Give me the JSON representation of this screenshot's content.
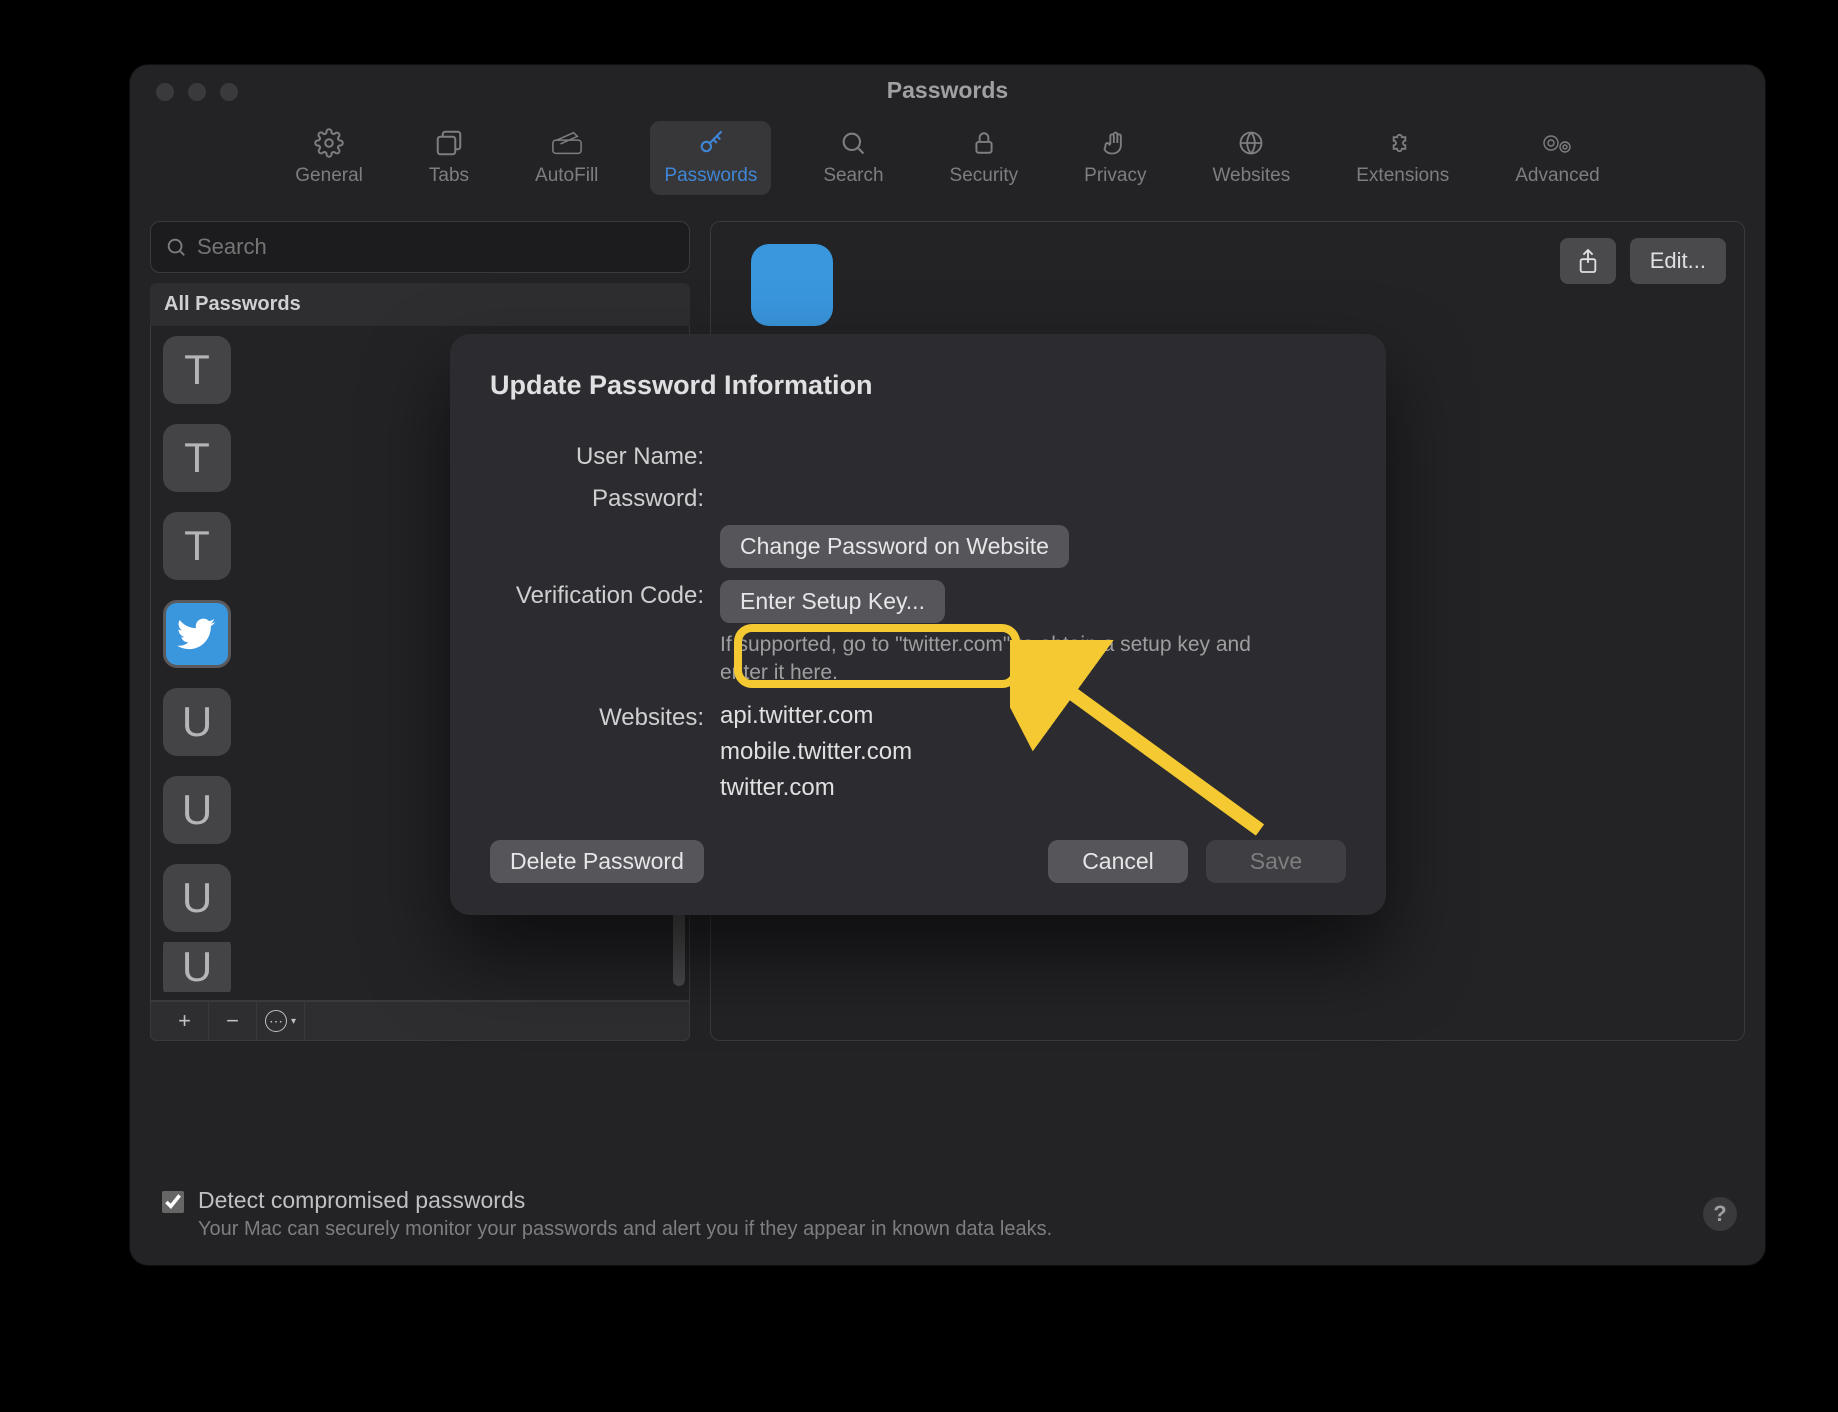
{
  "window": {
    "title": "Passwords"
  },
  "toolbar": {
    "items": [
      {
        "label": "General"
      },
      {
        "label": "Tabs"
      },
      {
        "label": "AutoFill"
      },
      {
        "label": "Passwords"
      },
      {
        "label": "Search"
      },
      {
        "label": "Security"
      },
      {
        "label": "Privacy"
      },
      {
        "label": "Websites"
      },
      {
        "label": "Extensions"
      },
      {
        "label": "Advanced"
      }
    ],
    "active_index": 3
  },
  "sidebar": {
    "search_placeholder": "Search",
    "all_passwords_label": "All Passwords",
    "items": [
      {
        "letter": "T"
      },
      {
        "letter": "T"
      },
      {
        "letter": "T"
      },
      {
        "letter": "twitter",
        "is_twitter": true
      },
      {
        "letter": "U"
      },
      {
        "letter": "U"
      },
      {
        "letter": "U"
      },
      {
        "letter": "U"
      }
    ],
    "footer": {
      "add": "+",
      "remove": "−",
      "more": "⋯"
    }
  },
  "panel": {
    "share_label": "Share",
    "edit_label": "Edit..."
  },
  "modal": {
    "title": "Update Password Information",
    "user_name_label": "User Name:",
    "password_label": "Password:",
    "change_password_button": "Change Password on Website",
    "verification_label": "Verification Code:",
    "enter_setup_key_button": "Enter Setup Key...",
    "verification_help": "If supported, go to \"twitter.com\" to obtain a setup key and enter it here.",
    "websites_label": "Websites:",
    "websites": [
      "api.twitter.com",
      "mobile.twitter.com",
      "twitter.com"
    ],
    "delete_button": "Delete Password",
    "cancel_button": "Cancel",
    "save_button": "Save"
  },
  "footer_check": {
    "title": "Detect compromised passwords",
    "subtitle": "Your Mac can securely monitor your passwords and alert you if they appear in known data leaks.",
    "checked": true
  },
  "help_button": "?"
}
